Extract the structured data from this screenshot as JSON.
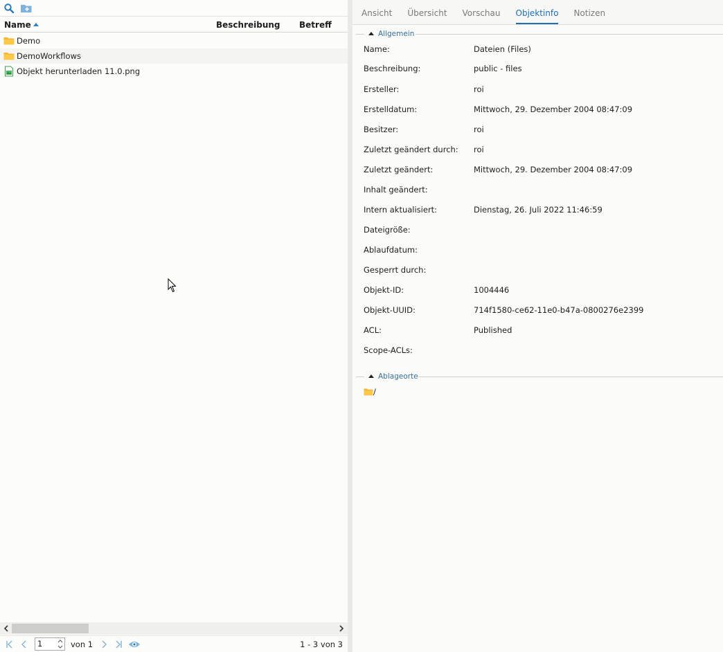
{
  "left": {
    "toolbar": {
      "icons": [
        "search-icon",
        "new-folder-icon"
      ]
    },
    "columns": {
      "name": "Name",
      "description": "Beschreibung",
      "subject": "Betreff"
    },
    "files": [
      {
        "name": "Demo",
        "icon": "folder-icon"
      },
      {
        "name": "DemoWorkflows",
        "icon": "folder-icon"
      },
      {
        "name": "Objekt herunterladen 11.0.png",
        "icon": "image-file-icon"
      }
    ],
    "pager": {
      "page": "1",
      "of_label": "von 1",
      "count": "1 - 3 von 3"
    }
  },
  "tabs": [
    {
      "label": "Ansicht",
      "active": false
    },
    {
      "label": "Übersicht",
      "active": false
    },
    {
      "label": "Vorschau",
      "active": false
    },
    {
      "label": "Objektinfo",
      "active": true
    },
    {
      "label": "Notizen",
      "active": false
    }
  ],
  "general": {
    "title": "Allgemein",
    "props": [
      {
        "key": "Name:",
        "value": "Dateien (Files)"
      },
      {
        "key": "Beschreibung:",
        "value": "public - files"
      },
      {
        "key": "Ersteller:",
        "value": "roi"
      },
      {
        "key": "Erstelldatum:",
        "value": "Mittwoch, 29. Dezember 2004 08:47:09"
      },
      {
        "key": "Besitzer:",
        "value": "roi"
      },
      {
        "key": "Zuletzt geändert durch:",
        "value": "roi"
      },
      {
        "key": "Zuletzt geändert:",
        "value": "Mittwoch, 29. Dezember 2004 08:47:09"
      },
      {
        "key": "Inhalt geändert:",
        "value": ""
      },
      {
        "key": "Intern aktualisiert:",
        "value": "Dienstag, 26. Juli 2022 11:46:59"
      },
      {
        "key": "Dateigröße:",
        "value": ""
      },
      {
        "key": "Ablaufdatum:",
        "value": ""
      },
      {
        "key": "Gesperrt durch:",
        "value": ""
      },
      {
        "key": "Objekt-ID:",
        "value": "1004446"
      },
      {
        "key": "Objekt-UUID:",
        "value": "714f1580-ce62-11e0-b47a-0800276e2399"
      },
      {
        "key": "ACL:",
        "value": "Published"
      },
      {
        "key": "Scope-ACLs:",
        "value": ""
      }
    ]
  },
  "locations": {
    "title": "Ablageorte",
    "items": [
      {
        "path": "/",
        "icon": "folder-icon"
      }
    ]
  },
  "colors": {
    "accent": "#1e6fb0",
    "folder": "#f7b731",
    "section_label": "#336e9a"
  }
}
